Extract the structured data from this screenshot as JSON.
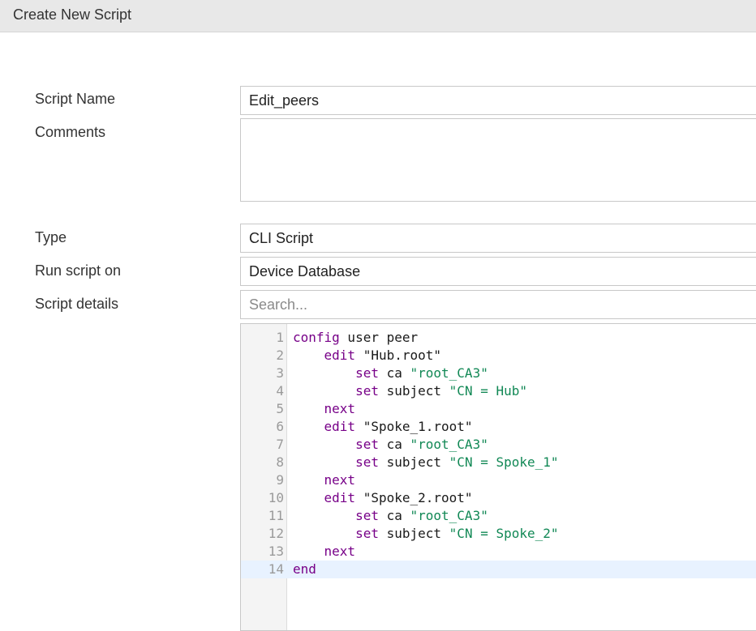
{
  "window": {
    "title": "Create New Script"
  },
  "form": {
    "script_name": {
      "label": "Script Name",
      "value": "Edit_peers"
    },
    "comments": {
      "label": "Comments",
      "value": ""
    },
    "type": {
      "label": "Type",
      "value": "CLI Script"
    },
    "run_on": {
      "label": "Run script on",
      "value": "Device Database"
    },
    "details": {
      "label": "Script details",
      "search_placeholder": "Search..."
    }
  },
  "editor": {
    "lines": [
      {
        "n": "1",
        "indent": "",
        "kw": "config",
        "rest": " user peer",
        "str": ""
      },
      {
        "n": "2",
        "indent": "    ",
        "kw": "edit",
        "rest": " \"Hub.root\"",
        "str": ""
      },
      {
        "n": "3",
        "indent": "        ",
        "kw": "set",
        "rest": " ca ",
        "str": "\"root_CA3\""
      },
      {
        "n": "4",
        "indent": "        ",
        "kw": "set",
        "rest": " subject ",
        "str": "\"CN = Hub\""
      },
      {
        "n": "5",
        "indent": "    ",
        "kw": "next",
        "rest": "",
        "str": ""
      },
      {
        "n": "6",
        "indent": "    ",
        "kw": "edit",
        "rest": " \"Spoke_1.root\"",
        "str": ""
      },
      {
        "n": "7",
        "indent": "        ",
        "kw": "set",
        "rest": " ca ",
        "str": "\"root_CA3\""
      },
      {
        "n": "8",
        "indent": "        ",
        "kw": "set",
        "rest": " subject ",
        "str": "\"CN = Spoke_1\""
      },
      {
        "n": "9",
        "indent": "    ",
        "kw": "next",
        "rest": "",
        "str": ""
      },
      {
        "n": "10",
        "indent": "    ",
        "kw": "edit",
        "rest": " \"Spoke_2.root\"",
        "str": ""
      },
      {
        "n": "11",
        "indent": "        ",
        "kw": "set",
        "rest": " ca ",
        "str": "\"root_CA3\""
      },
      {
        "n": "12",
        "indent": "        ",
        "kw": "set",
        "rest": " subject ",
        "str": "\"CN = Spoke_2\""
      },
      {
        "n": "13",
        "indent": "    ",
        "kw": "next",
        "rest": "",
        "str": ""
      },
      {
        "n": "14",
        "indent": "",
        "kw": "end",
        "rest": "",
        "str": ""
      }
    ],
    "active_line": "14"
  }
}
